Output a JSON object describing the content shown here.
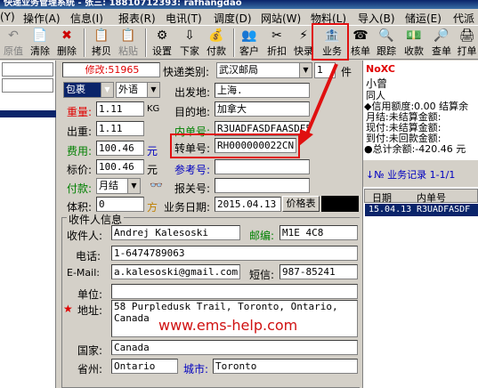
{
  "window": {
    "title": "快递业务管理系统 - 张三: 18810712393: rafhangdao"
  },
  "menu": [
    {
      "label": "(Y)"
    },
    {
      "label": "操作(A)"
    },
    {
      "label": "信息(I)"
    },
    {
      "label": "报表(R)"
    },
    {
      "label": "电讯(T)"
    },
    {
      "label": "调度(D)"
    },
    {
      "label": "网站(W)"
    },
    {
      "label": "物料(L)"
    },
    {
      "label": "导入(B)"
    },
    {
      "label": "储运(E)"
    },
    {
      "label": "代派"
    }
  ],
  "toolbar": {
    "items": [
      {
        "label": "原值",
        "icon": "↶",
        "disabled": true
      },
      {
        "label": "清除",
        "icon": "📄"
      },
      {
        "label": "删除",
        "icon": "✖"
      },
      {
        "label": "拷贝",
        "icon": "📋"
      },
      {
        "label": "粘贴",
        "icon": "📋",
        "disabled": true
      },
      {
        "label": "设置",
        "icon": "⚙"
      },
      {
        "label": "下家",
        "icon": "⇩"
      },
      {
        "label": "付款",
        "icon": "💰"
      },
      {
        "label": "客户",
        "icon": "👥"
      },
      {
        "label": "折扣",
        "icon": "✂"
      },
      {
        "label": "快录",
        "icon": "⚡"
      },
      {
        "label": "业务",
        "icon": "🏦"
      },
      {
        "label": "核单",
        "icon": "☎"
      },
      {
        "label": "跟踪",
        "icon": "🔍"
      },
      {
        "label": "收款",
        "icon": "💵"
      },
      {
        "label": "查单",
        "icon": "🔎"
      },
      {
        "label": "打单",
        "icon": "🖨"
      }
    ]
  },
  "form": {
    "modified": "修改:51965",
    "express_type_label": "快递类别:",
    "express_type_value": "武汉邮局",
    "count_value": "1",
    "piece_unit": "件",
    "package_type": "包裹",
    "language": "外语",
    "origin_label": "出发地:",
    "origin_value": "上海.",
    "destination_label": "目的地:",
    "destination_value": "加拿大",
    "internal_no_label": "内单号:",
    "internal_no_value": "R3UADFASDFAASDF55",
    "transfer_no_label": "转单号:",
    "transfer_no_value": "RH000000022CN",
    "ref_no_label": "参考号:",
    "ref_no_value": "",
    "customs_no_label": "报关号:",
    "customs_no_value": "",
    "business_date_label": "业务日期:",
    "business_date_value": "2015.04.13",
    "price_table_button": "价格表",
    "weight_label": "重量:",
    "weight_value": "1.11",
    "weight_unit": "KG",
    "out_weight_label": "出重:",
    "out_weight_value": "1.11",
    "fee_label": "费用:",
    "fee_value": "100.46",
    "fee_unit": "元",
    "list_price_label": "标价:",
    "list_price_value": "100.46",
    "list_price_unit": "元",
    "payment_label": "付款:",
    "payment_value": "月结",
    "volume_label": "体积:",
    "volume_value": "0",
    "volume_unit": "方"
  },
  "recipient": {
    "group_title": "收件人信息",
    "name_label": "收件人:",
    "name_value": "Andrej Kalesoski",
    "postcode_label": "邮编:",
    "postcode_value": "M1E 4C8",
    "phone_label": "电话:",
    "phone_value": "1-6474789063",
    "email_label": "E-Mail:",
    "email_value": "a.kalesoski@gmail.com",
    "sms_label": "短信:",
    "sms_value": "987-85241",
    "company_label": "单位:",
    "company_value": "",
    "address_label": "地址:",
    "address_value": "58 Purpledusk Trail, Toronto, Ontario, Canada",
    "country_label": "国家:",
    "country_value": "Canada",
    "province_label": "省州:",
    "province_value": "Ontario",
    "city_label": "城市:",
    "city_value": "Toronto"
  },
  "right_panel": {
    "badge": "NoXC",
    "name": "小曾",
    "subtitle": "同人",
    "credit_line": "◆信用额度:0.00 结算余",
    "monthly": "月结:未结算金额:",
    "cash": "现付:未结算金额:",
    "cod": "到付:未回款金额:",
    "total": "●总计余额:-420.46 元",
    "records_title": "↓№ 业务记录 1-1/1",
    "table_headers": [
      "日期",
      "内单号"
    ],
    "rows": [
      [
        "15.04.13",
        "R3UADFASDF"
      ]
    ]
  },
  "watermark": "www.ems-help.com",
  "colors": {
    "highlight_red": "#e01010",
    "selection_blue": "#0a246a",
    "label_green": "#008000",
    "label_blue": "#0000c0"
  }
}
